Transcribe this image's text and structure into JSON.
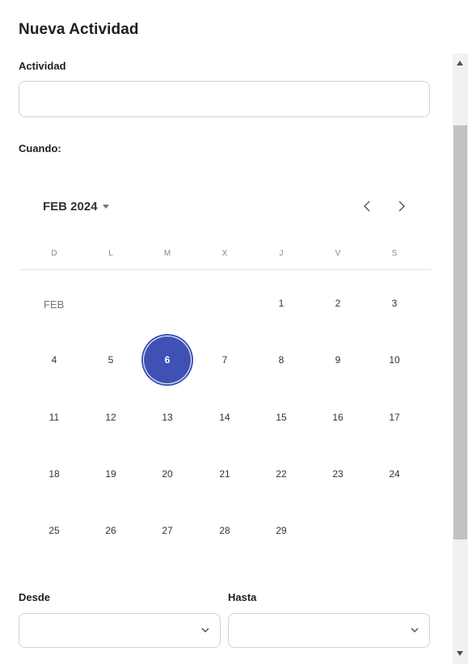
{
  "dialog": {
    "title": "Nueva Actividad",
    "activity_label": "Actividad",
    "activity_value": "",
    "when_label": "Cuando:"
  },
  "calendar": {
    "month_year": "FEB 2024",
    "month_short": "FEB",
    "weekdays": [
      "D",
      "L",
      "M",
      "X",
      "J",
      "V",
      "S"
    ],
    "weeks": [
      [
        "",
        "",
        "",
        "",
        "1",
        "2",
        "3"
      ],
      [
        "4",
        "5",
        "6",
        "7",
        "8",
        "9",
        "10"
      ],
      [
        "11",
        "12",
        "13",
        "14",
        "15",
        "16",
        "17"
      ],
      [
        "18",
        "19",
        "20",
        "21",
        "22",
        "23",
        "24"
      ],
      [
        "25",
        "26",
        "27",
        "28",
        "29",
        "",
        ""
      ]
    ],
    "selected_day": "6",
    "accent_color": "#3f51b5"
  },
  "time": {
    "from_label": "Desde",
    "from_value": "",
    "to_label": "Hasta",
    "to_value": ""
  },
  "icons": {
    "prev": "chevron-left-icon",
    "next": "chevron-right-icon",
    "dropdown": "chevron-down-icon",
    "month_caret": "caret-down-icon"
  }
}
